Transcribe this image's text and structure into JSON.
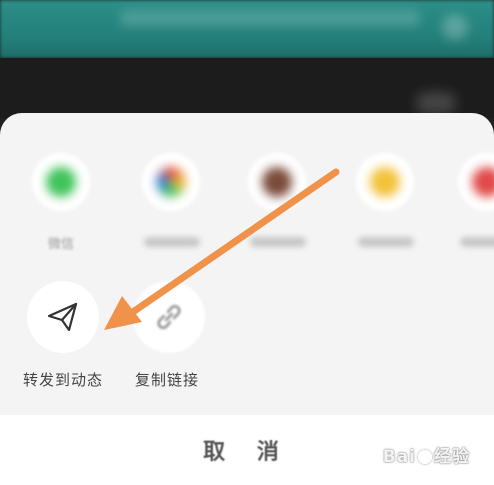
{
  "share_targets": [
    {
      "label": "微信",
      "icon": "wechat-icon",
      "color": "#3fc45a"
    },
    {
      "label": "",
      "icon": "photos-app-icon",
      "color": "#e8a02a"
    },
    {
      "label": "",
      "icon": "avatar-icon",
      "color": "#7a4a3a"
    },
    {
      "label": "",
      "icon": "sun-app-icon",
      "color": "#f3c23a"
    },
    {
      "label": "",
      "icon": "red-app-icon",
      "color": "#e04a4a"
    }
  ],
  "actions": {
    "forward": {
      "label": "转发到动态",
      "icon": "paper-plane-icon"
    },
    "copy_link": {
      "label": "复制链接",
      "icon": "link-icon"
    }
  },
  "cancel_label": "取 消",
  "watermark": {
    "text_left": "Bai",
    "text_right": "经验"
  },
  "annotation": {
    "arrow_color": "#f0924a"
  }
}
